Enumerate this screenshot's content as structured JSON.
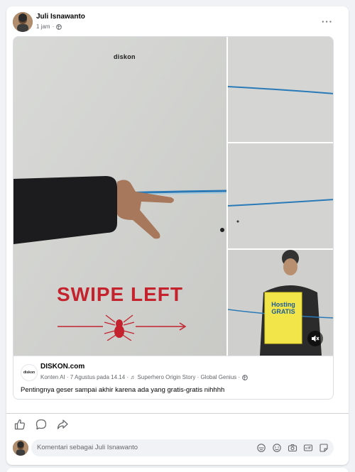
{
  "post": {
    "author": "Juli Isnawanto",
    "time": "1 jam",
    "separator": "·",
    "more_label": "···"
  },
  "shared": {
    "brand_logo": "diskon",
    "headline": "SWIPE LEFT",
    "poster_title": "Hosting GRATIS",
    "page_name": "DISKON.com",
    "page_meta": "Konten AI · 7 Agustus pada 14.14 · ♬ Superhero Origin Story · Global Genius ·",
    "page_logo": "diskon",
    "caption": "Pentingnya geser sampai akhir karena ada yang gratis-gratis nihhhh"
  },
  "actions": [
    "like-icon",
    "comment-icon",
    "share-icon"
  ],
  "comment": {
    "placeholder": "Komentari sebagai Juli Isnawanto"
  },
  "colors": {
    "accent_red": "#c4232e",
    "rope_blue": "#2a7ab8",
    "muted_text": "#65676b"
  }
}
